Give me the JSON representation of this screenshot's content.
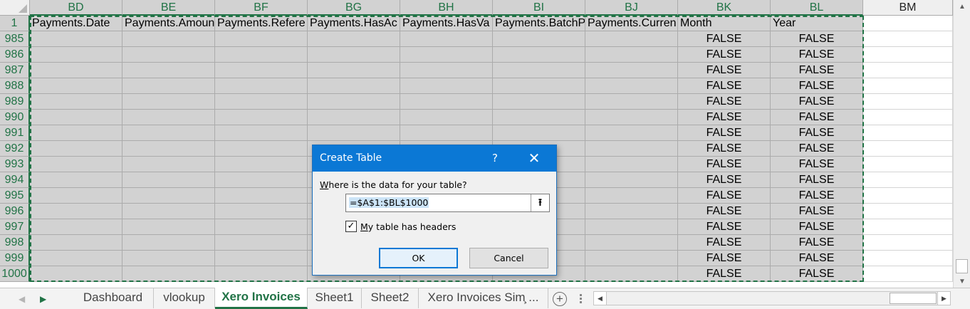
{
  "columns": [
    {
      "letter": "BD",
      "header": "Payments.Date",
      "selected": true
    },
    {
      "letter": "BE",
      "header": "Payments.Amoun",
      "selected": true
    },
    {
      "letter": "BF",
      "header": "Payments.Refere",
      "selected": true
    },
    {
      "letter": "BG",
      "header": "Payments.HasAc",
      "selected": true
    },
    {
      "letter": "BH",
      "header": "Payments.HasVa",
      "selected": true
    },
    {
      "letter": "BI",
      "header": "Payments.BatchP",
      "selected": true
    },
    {
      "letter": "BJ",
      "header": "Payments.Curren",
      "selected": true
    },
    {
      "letter": "BK",
      "header": "Month",
      "selected": true
    },
    {
      "letter": "BL",
      "header": "Year",
      "selected": true
    },
    {
      "letter": "BM",
      "header": "",
      "selected": false
    }
  ],
  "header_row_number": "1",
  "rows": [
    {
      "num": "985",
      "month": "FALSE",
      "year": "FALSE"
    },
    {
      "num": "986",
      "month": "FALSE",
      "year": "FALSE"
    },
    {
      "num": "987",
      "month": "FALSE",
      "year": "FALSE"
    },
    {
      "num": "988",
      "month": "FALSE",
      "year": "FALSE"
    },
    {
      "num": "989",
      "month": "FALSE",
      "year": "FALSE"
    },
    {
      "num": "990",
      "month": "FALSE",
      "year": "FALSE"
    },
    {
      "num": "991",
      "month": "FALSE",
      "year": "FALSE"
    },
    {
      "num": "992",
      "month": "FALSE",
      "year": "FALSE"
    },
    {
      "num": "993",
      "month": "FALSE",
      "year": "FALSE"
    },
    {
      "num": "994",
      "month": "FALSE",
      "year": "FALSE"
    },
    {
      "num": "995",
      "month": "FALSE",
      "year": "FALSE"
    },
    {
      "num": "996",
      "month": "FALSE",
      "year": "FALSE"
    },
    {
      "num": "997",
      "month": "FALSE",
      "year": "FALSE"
    },
    {
      "num": "998",
      "month": "FALSE",
      "year": "FALSE"
    },
    {
      "num": "999",
      "month": "FALSE",
      "year": "FALSE"
    },
    {
      "num": "1000",
      "month": "FALSE",
      "year": "FALSE"
    }
  ],
  "sheet_tabs": [
    {
      "label": "Dashboard",
      "active": false
    },
    {
      "label": "vlookup",
      "active": false
    },
    {
      "label": "Xero Invoices",
      "active": true
    },
    {
      "label": "Sheet1",
      "active": false
    },
    {
      "label": "Sheet2",
      "active": false
    },
    {
      "label": "Xero Invoices Sim̧ ...",
      "active": false
    }
  ],
  "tab_nav": {
    "prev": "◀",
    "next": "▶"
  },
  "add_sheet_label": "+",
  "dialog": {
    "title": "Create Table",
    "help_label": "?",
    "close_label": "✕",
    "prompt": "Where is the data for your table?",
    "range_value": "=$A$1:$BL$1000",
    "collapse_label": "⭱",
    "checkbox_checked": true,
    "checkbox_mark": "✓",
    "checkbox_label": "My table has headers",
    "ok_label": "OK",
    "cancel_label": "Cancel"
  },
  "colors": {
    "excel_green": "#217346",
    "dialog_blue": "#0b78d5",
    "selection_gray": "#d2d2d2"
  }
}
